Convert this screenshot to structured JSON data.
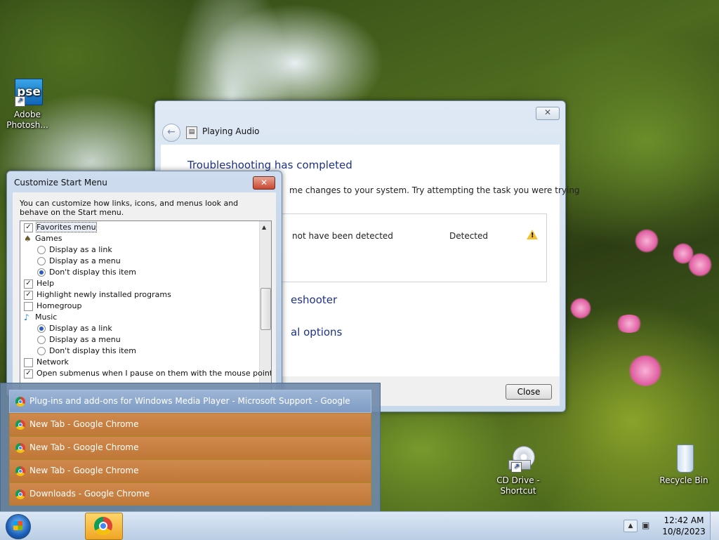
{
  "desktop": {
    "icons": [
      {
        "label": "Adobe Photosh...",
        "icon": "photoshop-elements-icon",
        "badge": "pse"
      },
      {
        "label": "CD Drive - Shortcut",
        "icon": "cd-drive-icon"
      },
      {
        "label": "Recycle Bin",
        "icon": "recycle-bin-icon"
      }
    ]
  },
  "troubleshooter": {
    "title": "Playing Audio",
    "heading": "Troubleshooting has completed",
    "description": "me changes to your system. Try attempting the task you were trying",
    "issue_text": "not have been detected",
    "issue_status": "Detected",
    "link_troubleshooter": "eshooter",
    "link_options": "al options",
    "close_label": "Close",
    "close_x": "✕",
    "back_glyph": "←"
  },
  "customize_start_menu": {
    "title": "Customize Start Menu",
    "close_x": "✕",
    "description": "You can customize how links, icons, and menus look and behave on the Start menu.",
    "items": [
      {
        "label": "Favorites menu",
        "kind": "checkbox",
        "checked": true,
        "selected": true
      },
      {
        "label": "Games",
        "kind": "group",
        "icon": "games-icon"
      },
      {
        "label": "Display as a link",
        "kind": "radio",
        "checked": false
      },
      {
        "label": "Display as a menu",
        "kind": "radio",
        "checked": false
      },
      {
        "label": "Don't display this item",
        "kind": "radio",
        "checked": true
      },
      {
        "label": "Help",
        "kind": "checkbox",
        "checked": true
      },
      {
        "label": "Highlight newly installed programs",
        "kind": "checkbox",
        "checked": true
      },
      {
        "label": "Homegroup",
        "kind": "checkbox",
        "checked": false
      },
      {
        "label": "Music",
        "kind": "group",
        "icon": "music-note-icon"
      },
      {
        "label": "Display as a link",
        "kind": "radio",
        "checked": true
      },
      {
        "label": "Display as a menu",
        "kind": "radio",
        "checked": false
      },
      {
        "label": "Don't display this item",
        "kind": "radio",
        "checked": false
      },
      {
        "label": "Network",
        "kind": "checkbox",
        "checked": false
      },
      {
        "label": "Open submenus when I pause on them with the mouse pointer",
        "kind": "checkbox",
        "checked": true
      }
    ]
  },
  "taskbar_thumbnails": [
    {
      "label": "Plug-ins and add-ons for Windows Media Player - Microsoft Support - Google Chrome",
      "active": true
    },
    {
      "label": "New Tab - Google Chrome",
      "active": false
    },
    {
      "label": "New Tab - Google Chrome",
      "active": false
    },
    {
      "label": "New Tab - Google Chrome",
      "active": false
    },
    {
      "label": "Downloads - Google Chrome",
      "active": false
    }
  ],
  "taskbar": {
    "time": "12:42 AM",
    "date": "10/8/2023",
    "tray_up": "▲",
    "network_glyph": "▣"
  },
  "colors": {
    "heading_blue": "#1e3287",
    "thumbnail_orange": "#c07838",
    "thumbnail_active": "#7f9bc4"
  }
}
